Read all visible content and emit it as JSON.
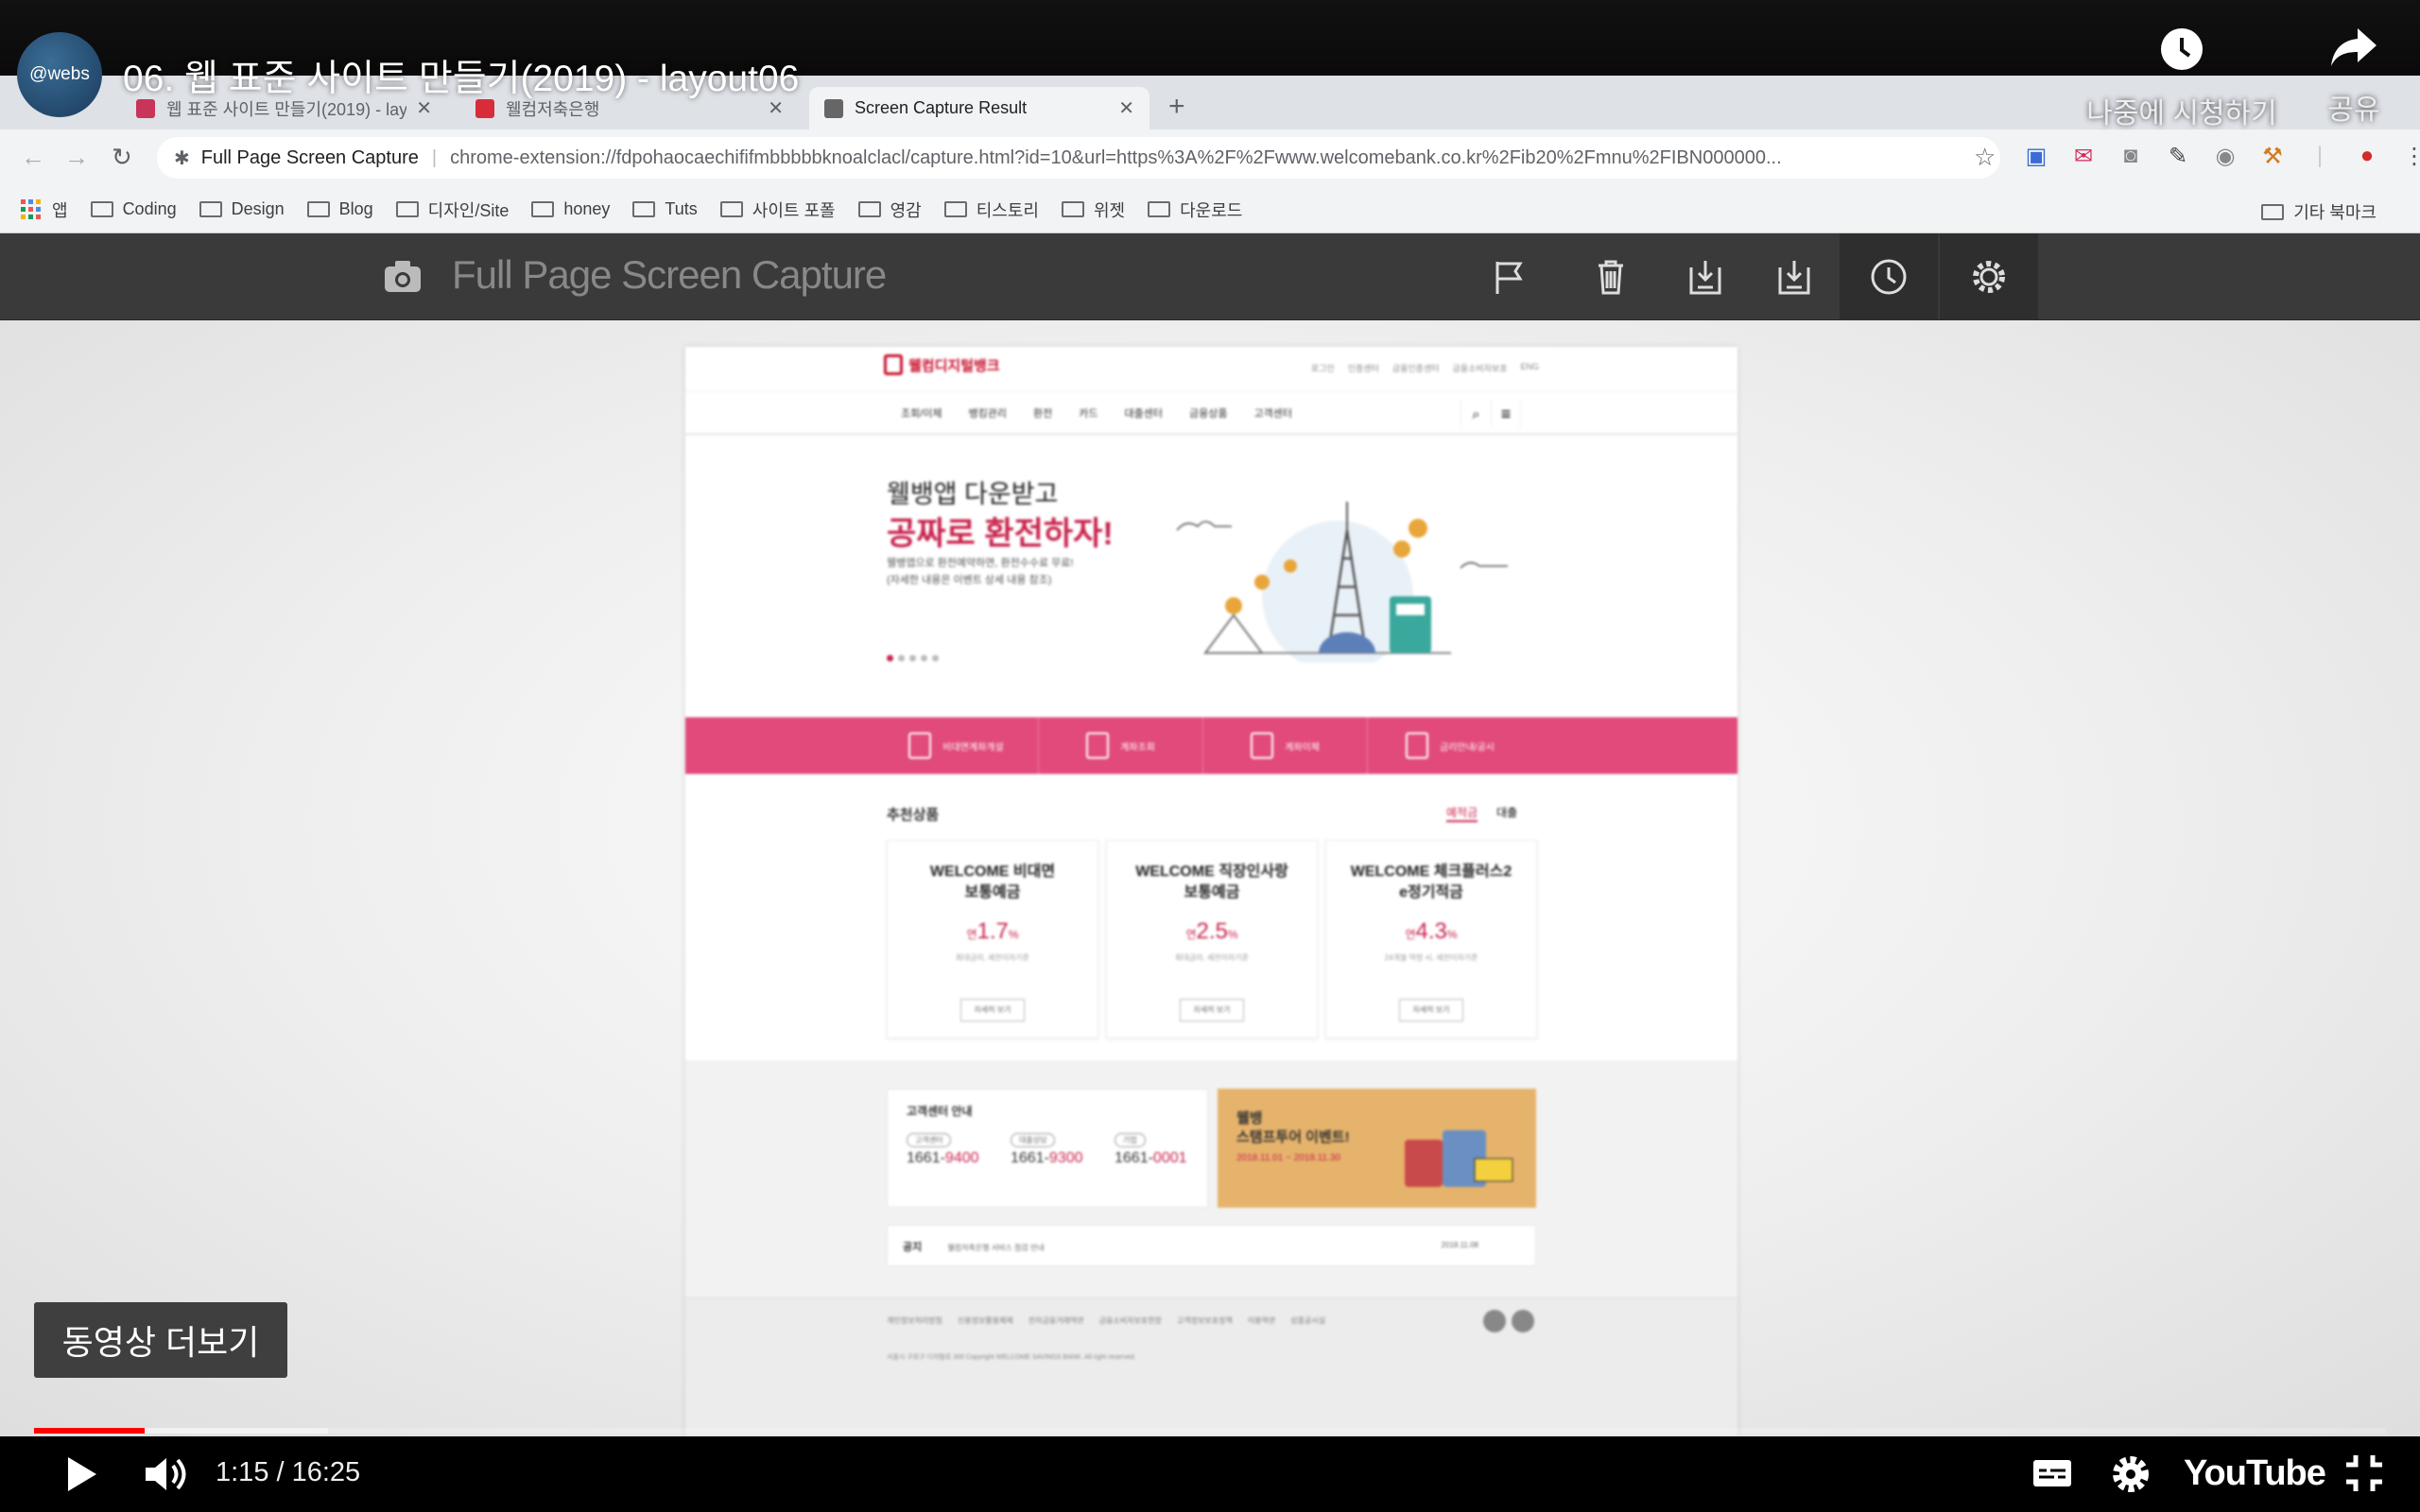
{
  "player": {
    "video_title": "06. 웹 표준 사이트 만들기(2019) - layout06",
    "channel_avatar": "@webs",
    "watch_later_label": "나중에 시청하기",
    "share_label": "공유",
    "more_videos_label": "동영상 더보기",
    "time_display": "1:15 / 16:25",
    "progress": {
      "played_fraction": 0.047,
      "buffered_fraction": 0.125
    },
    "brand": "YouTube",
    "icons": [
      "clock-icon",
      "share-arrow-icon",
      "play-icon",
      "volume-icon",
      "subtitles-icon",
      "settings-gear-icon",
      "exit-fullscreen-icon"
    ],
    "colors": {
      "progress": "#ff0000",
      "bar": "#000000"
    }
  },
  "browser": {
    "tabs": [
      {
        "label": "웹 표준 사이트 만들기(2019) - layo",
        "active": false,
        "fav_color": "#c8345a"
      },
      {
        "label": "웰컴저축은행",
        "active": false,
        "fav_color": "#d92c3a"
      },
      {
        "label": "Screen Capture Result",
        "active": true,
        "fav_color": "#666666"
      }
    ],
    "address": {
      "extension_name": "Full Page Screen Capture",
      "url": "chrome-extension://fdpohaocaechififmbbbbbknoalclacl/capture.html?id=10&url=https%3A%2F%2Fwww.welcomebank.co.kr%2Fib20%2Fmnu%2FIBN000000..."
    },
    "bookmarks": [
      "앱",
      "Coding",
      "Design",
      "Blog",
      "디자인/Site",
      "honey",
      "Tuts",
      "사이트 포폴",
      "영감",
      "티스토리",
      "위젯",
      "다운로드"
    ],
    "bookmarks_right": "기타 북마크"
  },
  "capture": {
    "title": "Full Page Screen Capture",
    "icons": [
      "flag-icon",
      "trash-icon",
      "download-icon",
      "download-pdf-icon",
      "history-icon",
      "settings-icon"
    ]
  },
  "site": {
    "logo": "웰컴디지털뱅크",
    "top_links": [
      "로그인",
      "인증센터",
      "금융인증센터",
      "금융소비자보호",
      "ENG"
    ],
    "gnb": [
      "조회/이체",
      "뱅킹관리",
      "환전",
      "카드",
      "대출센터",
      "금융상품",
      "고객센터"
    ],
    "hero": {
      "line1": "웰뱅앱 다운받고",
      "line2": "공짜로 환전하자!",
      "desc1": "웰뱅앱으로 환전예약하면, 환전수수료 무료!",
      "desc2": "(자세한 내용은 이벤트 상세 내용 참조)"
    },
    "quick": [
      "비대면계좌개설",
      "계좌조회",
      "계좌이체",
      "금리안내/공시"
    ],
    "rec_title": "추천상품",
    "rec_tabs": [
      "예적금",
      "대출"
    ],
    "cards": [
      {
        "name1": "WELCOME 비대면",
        "name2": "보통예금",
        "rate": "1.7",
        "desc": "최대금리, 세전이자기준",
        "btn": "자세히 보기"
      },
      {
        "name1": "WELCOME 직장인사랑",
        "name2": "보통예금",
        "rate": "2.5",
        "desc": "최대금리, 세전이자기준",
        "btn": "자세히 보기"
      },
      {
        "name1": "WELCOME 체크플러스2",
        "name2": "e정기적금",
        "rate": "4.3",
        "desc": "24개월 약정 시, 세전이자기준",
        "btn": "자세히 보기"
      }
    ],
    "rate_prefix": "연",
    "rate_suffix": "%",
    "cs": {
      "title": "고객센터 안내",
      "nums": [
        {
          "tag": "고객센터",
          "pre": "1661-",
          "post": "9400"
        },
        {
          "tag": "대출상담",
          "pre": "1661-",
          "post": "9300"
        },
        {
          "tag": "기업",
          "pre": "1661-",
          "post": "0001"
        }
      ]
    },
    "event": {
      "line1": "웰뱅",
      "line2": "스탬프투어 이벤트!",
      "date": "2018.11.01 ~ 2018.11.30"
    },
    "notice": {
      "label": "공지",
      "text": "웰컴저축은행 서비스 점검 안내",
      "date": "2018.11.08"
    },
    "footer_links": [
      "개인정보처리방침",
      "신용정보활용체제",
      "전자금융거래약관",
      "금융소비자보호헌장",
      "고객정보보호정책",
      "이용약관",
      "상품공시실"
    ],
    "footer_info": "서울시 구로구 디지털로 300  Copyright WELCOME SAVINGS BANK. All right reserved."
  }
}
